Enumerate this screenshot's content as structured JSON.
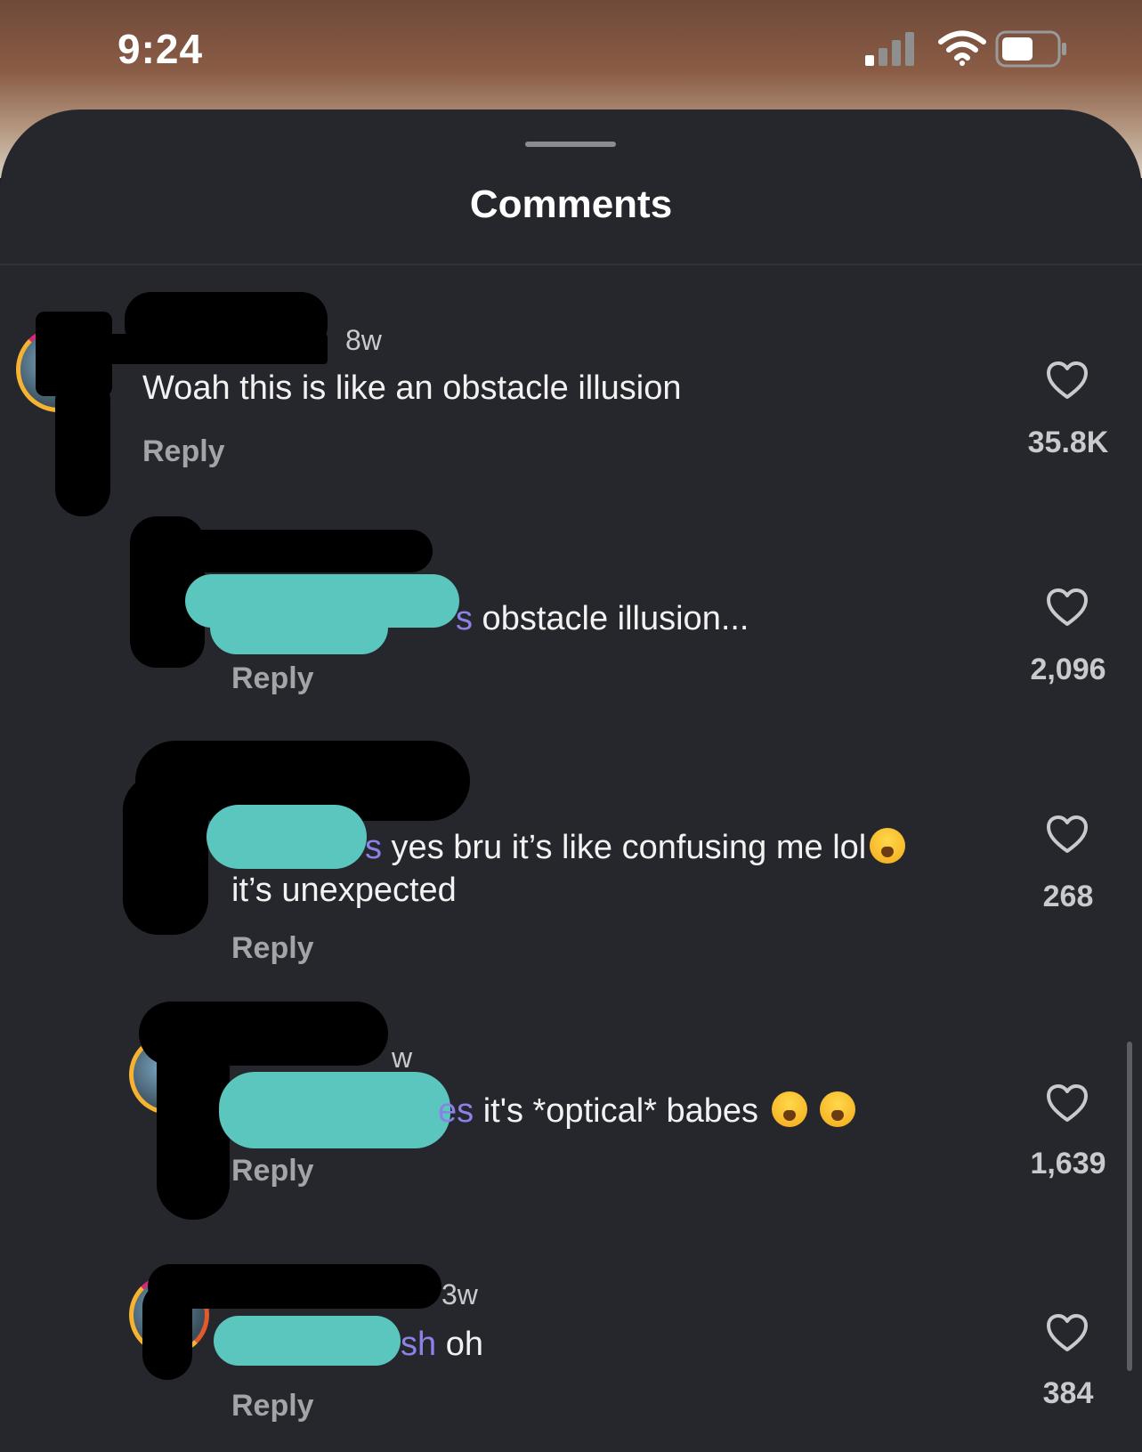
{
  "status_bar": {
    "time": "9:24"
  },
  "sheet": {
    "title": "Comments"
  },
  "comments": [
    {
      "time": "8w",
      "mention": "",
      "text": "Woah this is like an obstacle illusion",
      "text2": "",
      "emojis": 0,
      "reply": "Reply",
      "likes": "35.8K"
    },
    {
      "time": "",
      "mention": "s",
      "text": " obstacle illusion...",
      "text2": "",
      "emojis": 0,
      "reply": "Reply",
      "likes": "2,096"
    },
    {
      "time": "",
      "mention": "s",
      "text": " yes bru it’s like confusing me lol",
      "text2": "it’s unexpected",
      "emojis": 1,
      "reply": "Reply",
      "likes": "268"
    },
    {
      "time": "w",
      "mention": "es",
      "text": " it's *optical* babes ",
      "text2": "",
      "emojis": 2,
      "reply": "Reply",
      "likes": "1,639"
    },
    {
      "time": "3w",
      "mention": "sh",
      "text": " oh",
      "text2": "",
      "emojis": 0,
      "reply": "Reply",
      "likes": "384"
    }
  ],
  "colors": {
    "sheet_bg": "#25272d",
    "mention": "#8a82e6",
    "redaction_teal": "#5ac6bd"
  }
}
